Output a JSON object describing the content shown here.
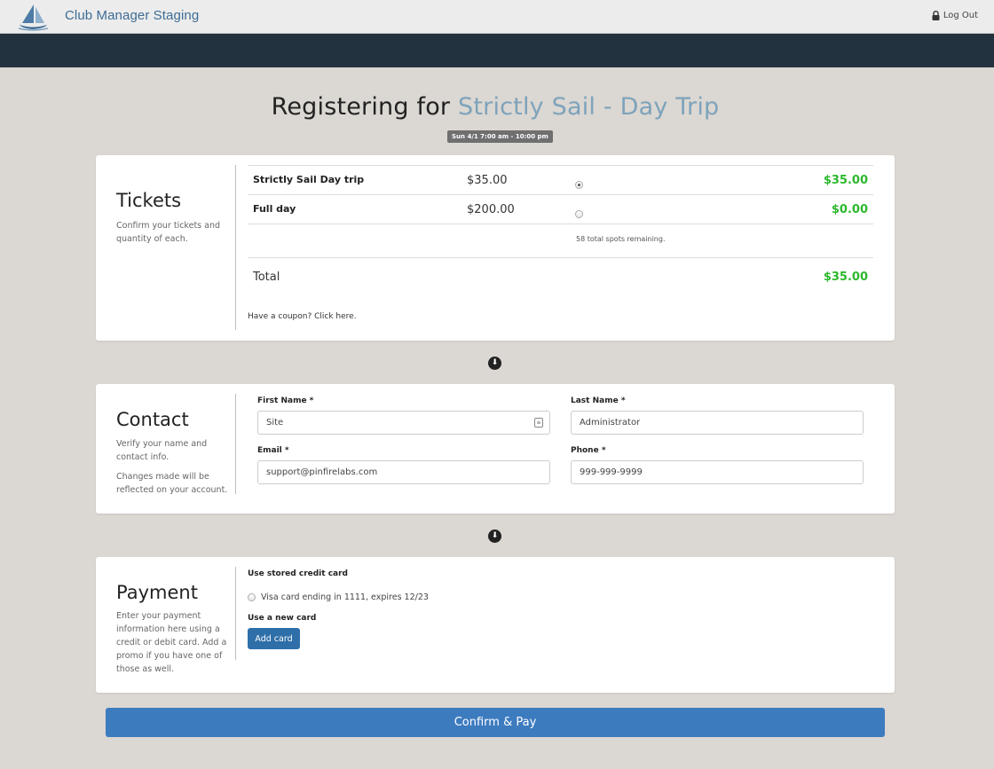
{
  "app": {
    "title": "Club Manager Staging",
    "logout_label": "Log Out"
  },
  "event": {
    "heading_prefix": "Registering for ",
    "name": "Strictly Sail - Day Trip",
    "date_badge": "Sun 4/1 7:00 am - 10:00 pm"
  },
  "tickets": {
    "title": "Tickets",
    "description": "Confirm your tickets and quantity of each.",
    "items": [
      {
        "name": "Strictly Sail Day trip",
        "price": "$35.00",
        "selected": true,
        "subtotal": "$35.00"
      },
      {
        "name": "Full day",
        "price": "$200.00",
        "selected": false,
        "subtotal": "$0.00"
      }
    ],
    "spots_remaining": "58 total spots remaining.",
    "total_label": "Total",
    "total_value": "$35.00",
    "coupon_link": "Have a coupon? Click here."
  },
  "contact": {
    "title": "Contact",
    "description1": "Verify your name and contact info.",
    "description2": "Changes made will be reflected on your account.",
    "first_name_label": "First Name *",
    "first_name_value": "Site",
    "last_name_label": "Last Name *",
    "last_name_value": "Administrator",
    "email_label": "Email *",
    "email_value": "support@pinfirelabs.com",
    "phone_label": "Phone *",
    "phone_value": "999-999-9999"
  },
  "payment": {
    "title": "Payment",
    "description": "Enter your payment information here using a credit or debit card. Add a promo if you have one of those as well.",
    "stored_heading": "Use stored credit card",
    "stored_card": "Visa card ending in 1111, expires 12/23",
    "new_heading": "Use a new card",
    "add_card_label": "Add card"
  },
  "confirm_label": "Confirm & Pay",
  "colors": {
    "accent": "#3d7bbf",
    "nav": "#23323f",
    "price_green": "#2db82d",
    "event_name": "#7ea3bb"
  }
}
